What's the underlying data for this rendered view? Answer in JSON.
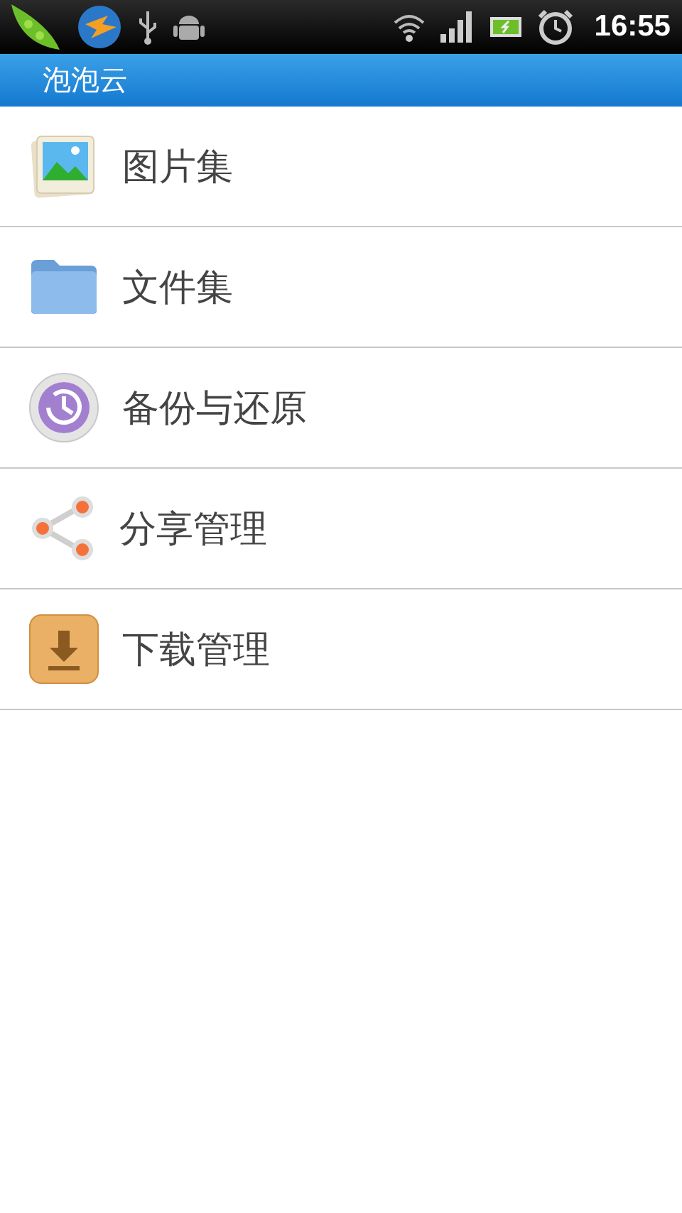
{
  "status_bar": {
    "time": "16:55"
  },
  "title_bar": {
    "title": "泡泡云"
  },
  "menu": [
    {
      "kind": "pictures",
      "label": "图片集"
    },
    {
      "kind": "files",
      "label": "文件集"
    },
    {
      "kind": "backup",
      "label": "备份与还原"
    },
    {
      "kind": "share",
      "label": "分享管理"
    },
    {
      "kind": "download",
      "label": "下载管理"
    }
  ]
}
